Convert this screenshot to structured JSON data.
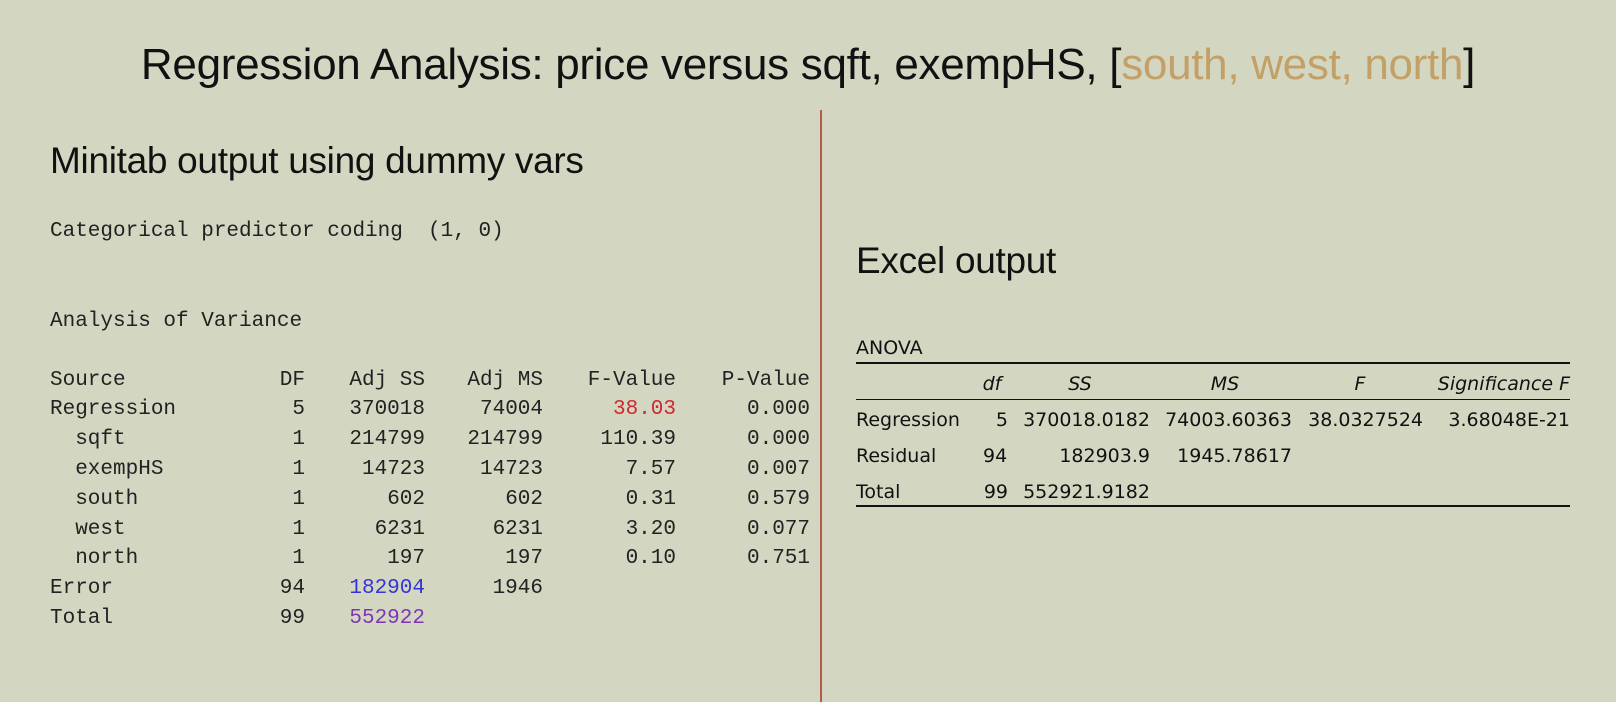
{
  "title": {
    "prefix": "Regression Analysis: price versus sqft, exempHS, [",
    "highlight": "south, west, north",
    "suffix": "]"
  },
  "minitab": {
    "heading": "Minitab output using dummy vars",
    "coding_line": "Categorical predictor coding  (1, 0)",
    "anova_heading": "Analysis of Variance",
    "columns": [
      "Source",
      "DF",
      "Adj SS",
      "Adj MS",
      "F-Value",
      "P-Value"
    ],
    "rows": [
      {
        "source": "Regression",
        "df": "5",
        "adj_ss": "370018",
        "adj_ms": "74004",
        "f": "38.03",
        "p": "0.000"
      },
      {
        "source": "  sqft",
        "df": "1",
        "adj_ss": "214799",
        "adj_ms": "214799",
        "f": "110.39",
        "p": "0.000"
      },
      {
        "source": "  exempHS",
        "df": "1",
        "adj_ss": "14723",
        "adj_ms": "14723",
        "f": "7.57",
        "p": "0.007"
      },
      {
        "source": "  south",
        "df": "1",
        "adj_ss": "602",
        "adj_ms": "602",
        "f": "0.31",
        "p": "0.579"
      },
      {
        "source": "  west",
        "df": "1",
        "adj_ss": "6231",
        "adj_ms": "6231",
        "f": "3.20",
        "p": "0.077"
      },
      {
        "source": "  north",
        "df": "1",
        "adj_ss": "197",
        "adj_ms": "197",
        "f": "0.10",
        "p": "0.751"
      },
      {
        "source": "Error",
        "df": "94",
        "adj_ss": "182904",
        "adj_ms": "1946",
        "f": "",
        "p": ""
      },
      {
        "source": "Total",
        "df": "99",
        "adj_ss": "552922",
        "adj_ms": "",
        "f": "",
        "p": ""
      }
    ]
  },
  "excel": {
    "heading": "Excel output",
    "table_label": "ANOVA",
    "columns": [
      "df",
      "SS",
      "MS",
      "F",
      "Significance F"
    ],
    "rows": [
      {
        "source": "Regression",
        "df": "5",
        "ss": "370018.0182",
        "ms": "74003.60363",
        "f": "38.0327524",
        "sig": "3.68048E-21"
      },
      {
        "source": "Residual",
        "df": "94",
        "ss": "182903.9",
        "ms": "1945.78617",
        "f": "",
        "sig": ""
      },
      {
        "source": "Total",
        "df": "99",
        "ss": "552921.9182",
        "ms": "",
        "f": "",
        "sig": ""
      }
    ]
  },
  "colors": {
    "background": "#d3d7c2",
    "highlight_tan": "#c2a068",
    "f_value_red": "#d0282e",
    "error_ss_blue": "#3434d8",
    "total_ss_purple": "#7e34b4",
    "divider": "#b85a4a"
  }
}
